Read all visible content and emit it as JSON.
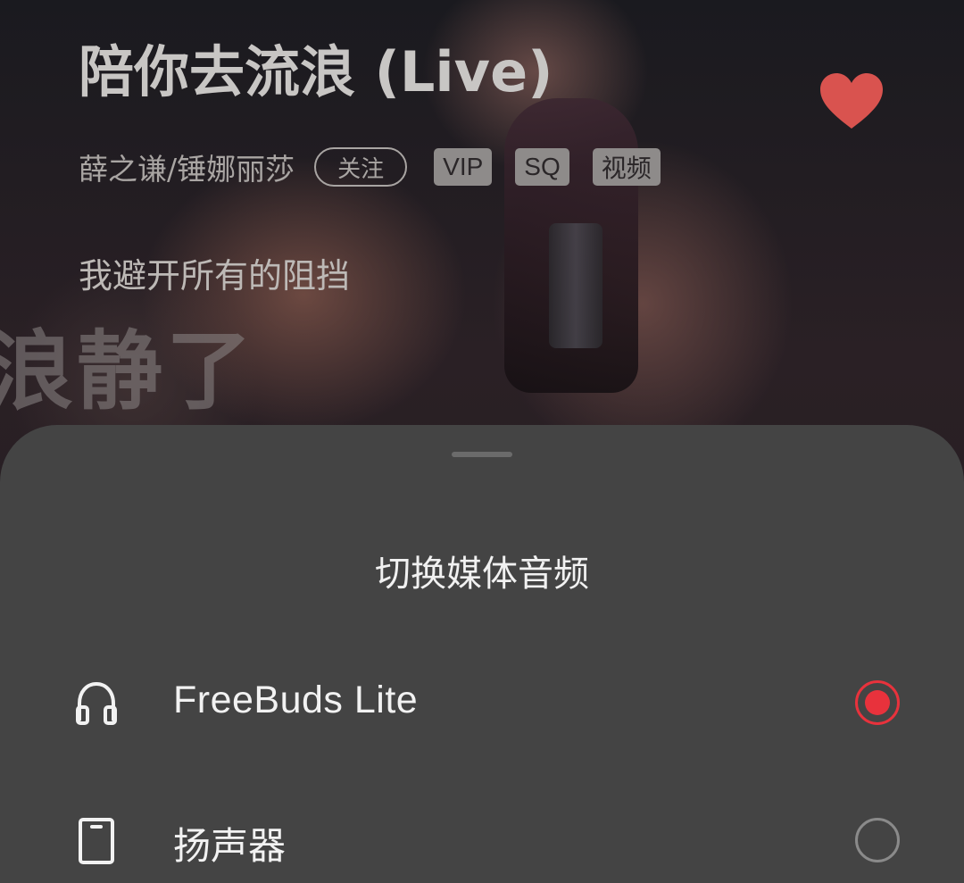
{
  "now_playing": {
    "title": "陪你去流浪 (Live)",
    "artists": "薛之谦/锤娜丽莎",
    "follow_label": "关注",
    "badges": [
      "VIP",
      "SQ",
      "视频"
    ],
    "lyric": "我避开所有的阻挡",
    "video_subtitle": "浪静了",
    "liked": true,
    "like_icon": "heart-icon",
    "like_color": "#d9534f"
  },
  "audio_output_sheet": {
    "title": "切换媒体音频",
    "devices": [
      {
        "label": "FreeBuds Lite",
        "icon": "headphones-icon",
        "selected": true
      },
      {
        "label": "扬声器",
        "icon": "phone-speaker-icon",
        "selected": false
      }
    ],
    "accent_color": "#e8323c"
  }
}
